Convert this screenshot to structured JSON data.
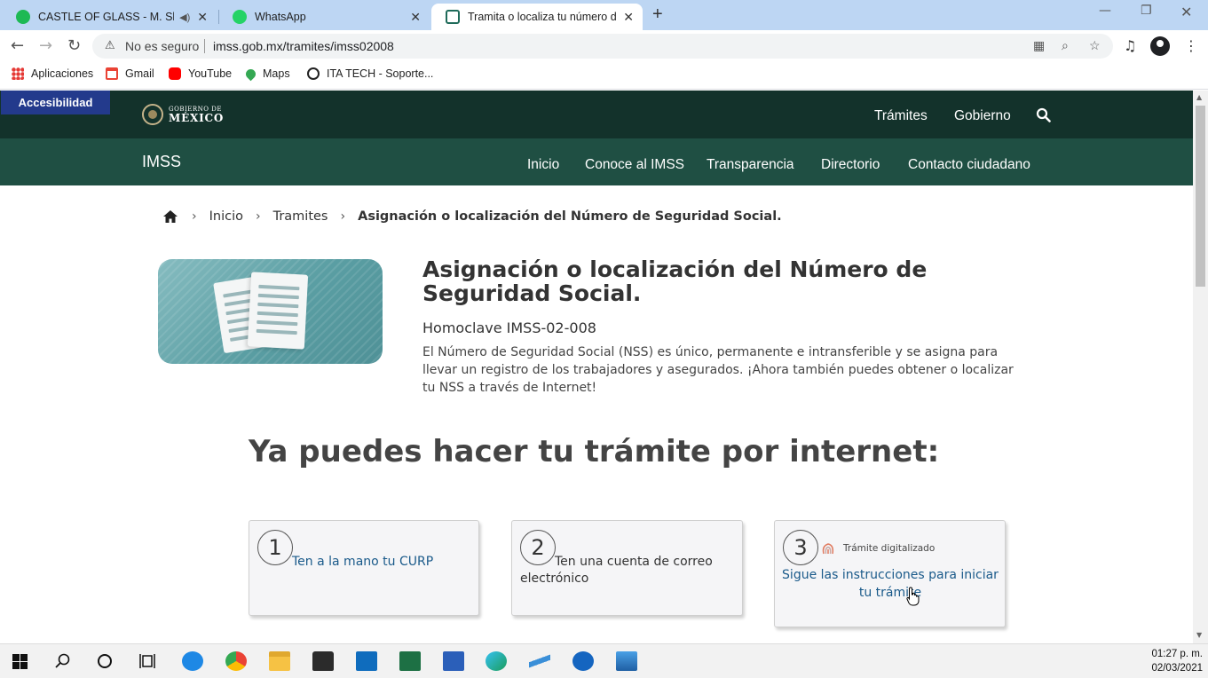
{
  "browser": {
    "tabs": [
      {
        "title": "CASTLE OF GLASS - M. Shinoda",
        "favicon": "spotify-icon",
        "audio": true
      },
      {
        "title": "WhatsApp",
        "favicon": "whatsapp-icon"
      },
      {
        "title": "Tramita o localiza tu número de seguridad social",
        "favicon": "gob-mx-icon",
        "active": true
      }
    ],
    "address": {
      "security_label": "No es seguro",
      "url": "imss.gob.mx/tramites/imss02008"
    },
    "bookmarks": [
      {
        "label": "Aplicaciones",
        "icon": "apps-grid-icon"
      },
      {
        "label": "Gmail",
        "icon": "gmail-icon"
      },
      {
        "label": "YouTube",
        "icon": "youtube-icon"
      },
      {
        "label": "Maps",
        "icon": "maps-icon"
      },
      {
        "label": "ITA TECH - Soporte...",
        "icon": "globe-icon"
      }
    ]
  },
  "gov_header": {
    "accessibility_label": "Accesibilidad",
    "logo_line1": "GOBIERNO DE",
    "logo_line2": "MÉXICO",
    "links": [
      "Trámites",
      "Gobierno"
    ]
  },
  "imss_nav": {
    "title": "IMSS",
    "links": [
      "Inicio",
      "Conoce al IMSS",
      "Transparencia",
      "Directorio",
      "Contacto ciudadano"
    ]
  },
  "breadcrumb": {
    "items": [
      "Inicio",
      "Tramites"
    ],
    "current": "Asignación o localización del Número de Seguridad Social."
  },
  "tramite": {
    "title": "Asignación o localización del Número de Seguridad Social.",
    "homoclave": "Homoclave IMSS-02-008",
    "description": "El Número de Seguridad Social (NSS) es único, permanente e intransferible y se asigna para llevar un registro de los trabajadores y asegurados. ¡Ahora también puedes obtener o localizar tu NSS a través de Internet!"
  },
  "online": {
    "heading": "Ya puedes hacer tu trámite por internet:",
    "steps": [
      {
        "number": "1",
        "text": "Ten a la mano tu CURP"
      },
      {
        "number": "2",
        "text": "Ten una cuenta de correo electrónico"
      },
      {
        "number": "3",
        "tag": "Trámite digitalizado",
        "text": "Sigue las instrucciones para iniciar tu trámite"
      }
    ]
  },
  "taskbar": {
    "time": "01:27 p. m.",
    "date": "02/03/2021"
  },
  "colors": {
    "gov_dark": "#13322b",
    "imss_green": "#1f4f43",
    "accessibility_blue": "#233a8c",
    "link_blue": "#1a5a8a"
  }
}
